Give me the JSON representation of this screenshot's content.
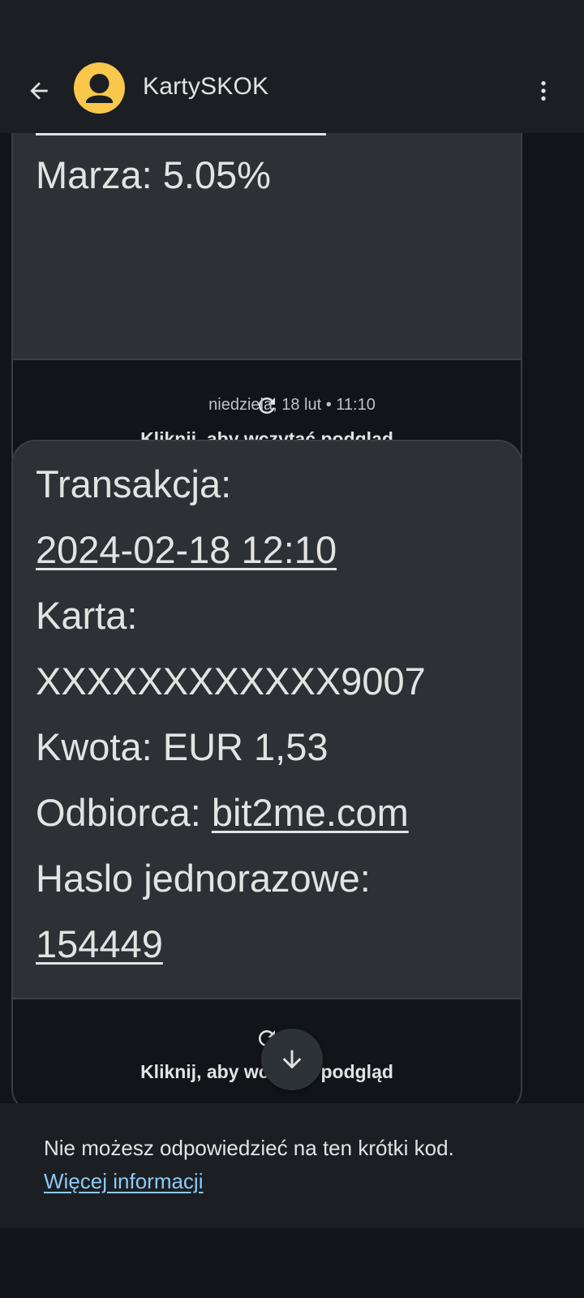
{
  "header": {
    "contact_name": "KartySKOK",
    "back_icon": "arrow-left-icon",
    "more_icon": "more-vert-icon",
    "avatar_color": "#f9c84a"
  },
  "messages": [
    {
      "lines_visible": [
        "Marza: 5.05%"
      ],
      "preview_label": "Kliknij, aby wczytać podgląd"
    },
    {
      "timestamp": "niedziela, 18 lut • 11:10",
      "line1": "Transakcja:",
      "date": "2024-02-18 12:10",
      "line3": "Karta:",
      "card": "XXXXXXXXXXXX9007",
      "amount": "Kwota: EUR 1,53",
      "recipient_label": "Odbiorca: ",
      "recipient_link": "bit2me.com",
      "otp_label": "Haslo jednorazowe:",
      "otp": "154449",
      "preview_label": "Kliknij, aby wczytać podgląd"
    }
  ],
  "footer": {
    "text": "Nie możesz odpowiedzieć na ten krótki kod.",
    "link": "Więcej informacji",
    "link_color": "#8ecaf5"
  },
  "scroll_fab_icon": "arrow-down-icon"
}
